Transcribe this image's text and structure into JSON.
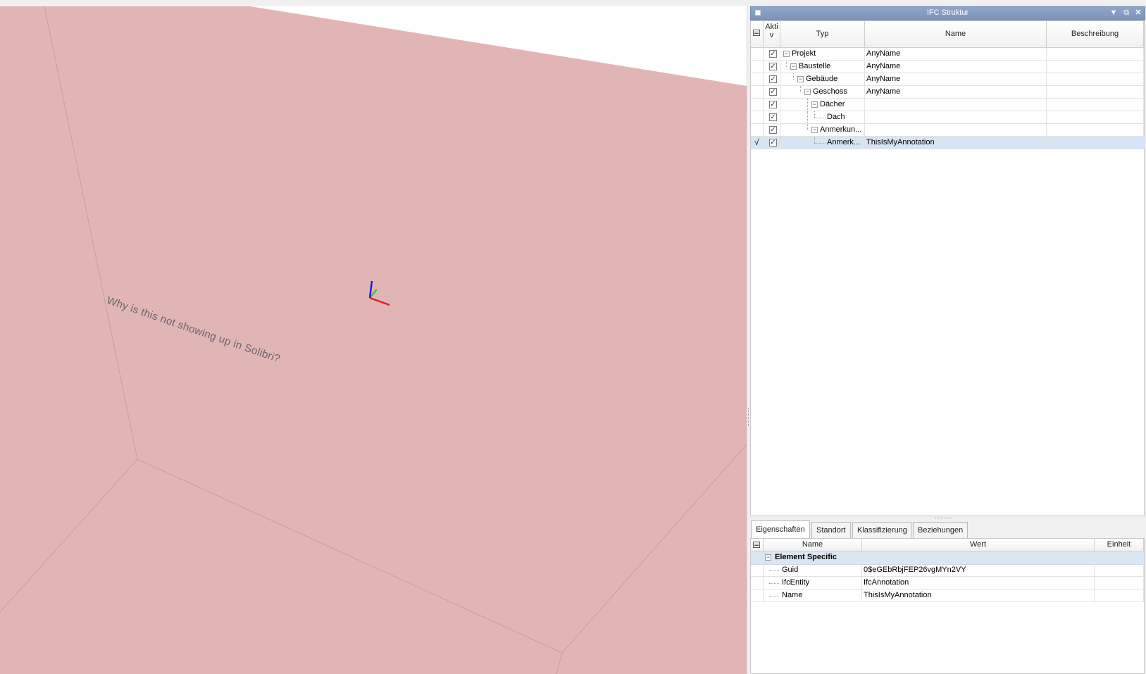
{
  "viewport": {
    "annotation_text": "Why is this not showing up in Solibri?",
    "surface_color": "#e2b5b5",
    "axis_colors": {
      "x": "#e02020",
      "y": "#3fc43f",
      "z": "#1a1aee"
    }
  },
  "ifc_panel": {
    "title": "IFC Struktur",
    "columns": {
      "aktiv": "Akti\nv",
      "typ": "Typ",
      "name": "Name",
      "beschreibung": "Beschreibung"
    },
    "rows": [
      {
        "typ": "Projekt",
        "name": "AnyName",
        "beschreibung": "",
        "checked": true
      },
      {
        "typ": "Baustelle",
        "name": "AnyName",
        "beschreibung": "",
        "checked": true
      },
      {
        "typ": "Gebäude",
        "name": "AnyName",
        "beschreibung": "",
        "checked": true
      },
      {
        "typ": "Geschoss",
        "name": "AnyName",
        "beschreibung": "",
        "checked": true
      },
      {
        "typ": "Dächer",
        "name": "",
        "beschreibung": "",
        "checked": true
      },
      {
        "typ": "Dach",
        "name": "",
        "beschreibung": "",
        "checked": true
      },
      {
        "typ": "Anmerkun...",
        "name": "",
        "beschreibung": "",
        "checked": true
      },
      {
        "typ": "Anmerk...",
        "name": "ThisIsMyAnnotation",
        "beschreibung": "",
        "checked": true,
        "selected": true,
        "marker": "√"
      }
    ],
    "checkmark": "✓"
  },
  "properties": {
    "tabs": [
      "Eigenschaften",
      "Standort",
      "Klassifizierung",
      "Beziehungen"
    ],
    "columns": {
      "name": "Name",
      "wert": "Wert",
      "einheit": "Einheit"
    },
    "group": "Element Specific",
    "rows": [
      {
        "name": "Guid",
        "wert": "0$eGEbRbjFEP26vgMYn2VY",
        "einheit": ""
      },
      {
        "name": "IfcEntity",
        "wert": "IfcAnnotation",
        "einheit": ""
      },
      {
        "name": "Name",
        "wert": "ThisIsMyAnnotation",
        "einheit": ""
      }
    ]
  }
}
